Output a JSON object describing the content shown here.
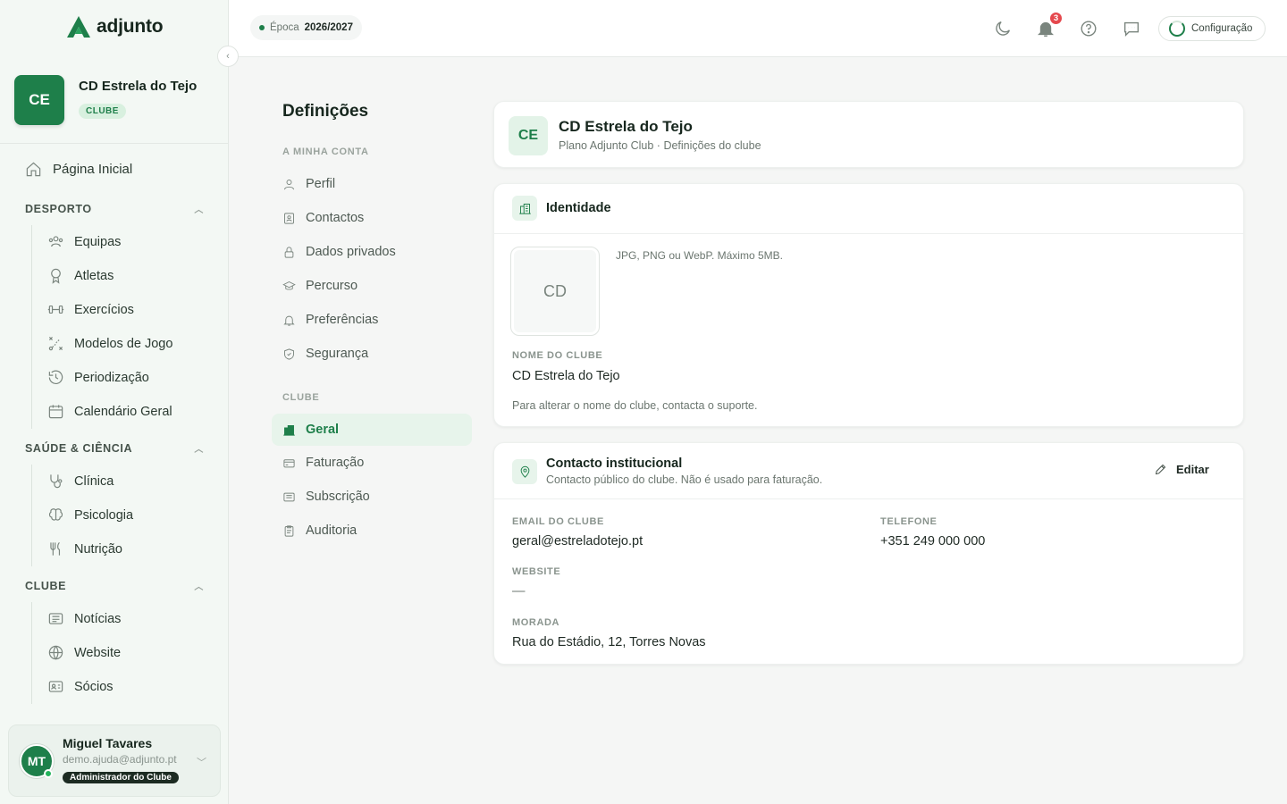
{
  "brand": {
    "name": "adjunto"
  },
  "club": {
    "initials": "CE",
    "name": "CD Estrela do Tejo",
    "tag": "CLUBE"
  },
  "sidebar": {
    "home": "Página Inicial",
    "sections": [
      {
        "title": "DESPORTO",
        "items": [
          "Equipas",
          "Atletas",
          "Exercícios",
          "Modelos de Jogo",
          "Periodização",
          "Calendário Geral"
        ]
      },
      {
        "title": "SAÚDE & CIÊNCIA",
        "items": [
          "Clínica",
          "Psicologia",
          "Nutrição"
        ]
      },
      {
        "title": "CLUBE",
        "items": [
          "Notícias",
          "Website",
          "Sócios"
        ]
      }
    ]
  },
  "user": {
    "initials": "MT",
    "name": "Miguel Tavares",
    "email": "demo.ajuda@adjunto.pt",
    "role": "Administrador do Clube"
  },
  "topbar": {
    "season_label": "Época",
    "season_value": "2026/2027",
    "notifications": "3",
    "config_label": "Configuração"
  },
  "settings": {
    "title": "Definições",
    "account_section": "A MINHA CONTA",
    "account_items": [
      "Perfil",
      "Contactos",
      "Dados privados",
      "Percurso",
      "Preferências",
      "Segurança"
    ],
    "club_section": "CLUBE",
    "club_items": [
      "Geral",
      "Faturação",
      "Subscrição",
      "Auditoria"
    ],
    "active": "Geral"
  },
  "hero": {
    "initials": "CE",
    "name": "CD Estrela do Tejo",
    "subtitle": "Plano Adjunto Club · Definições do clube"
  },
  "identity": {
    "title": "Identidade",
    "logo_placeholder": "CD",
    "logo_hint": "JPG, PNG ou WebP. Máximo 5MB.",
    "name_label": "NOME DO CLUBE",
    "name_value": "CD Estrela do Tejo",
    "name_note": "Para alterar o nome do clube, contacta o suporte."
  },
  "contact": {
    "title": "Contacto institucional",
    "subtitle": "Contacto público do clube. Não é usado para faturação.",
    "edit_label": "Editar",
    "email_label": "EMAIL DO CLUBE",
    "email_value": "geral@estreladotejo.pt",
    "phone_label": "TELEFONE",
    "phone_value": "+351 249 000 000",
    "website_label": "WEBSITE",
    "website_value": "—",
    "address_label": "MORADA",
    "address_value": "Rua do Estádio, 12, Torres Novas"
  },
  "colors": {
    "brand": "#1e7f4a",
    "badge": "#e5484d",
    "sidebar_bg": "#f3f8f4"
  },
  "icons": {
    "logo": "adjunto-logo-icon",
    "moon": "moon-icon",
    "bell": "bell-icon",
    "help": "help-circle-icon",
    "chat": "message-icon",
    "home": "home-icon",
    "edit": "pencil-icon",
    "identity": "building-icon",
    "contact": "map-pin-icon"
  }
}
